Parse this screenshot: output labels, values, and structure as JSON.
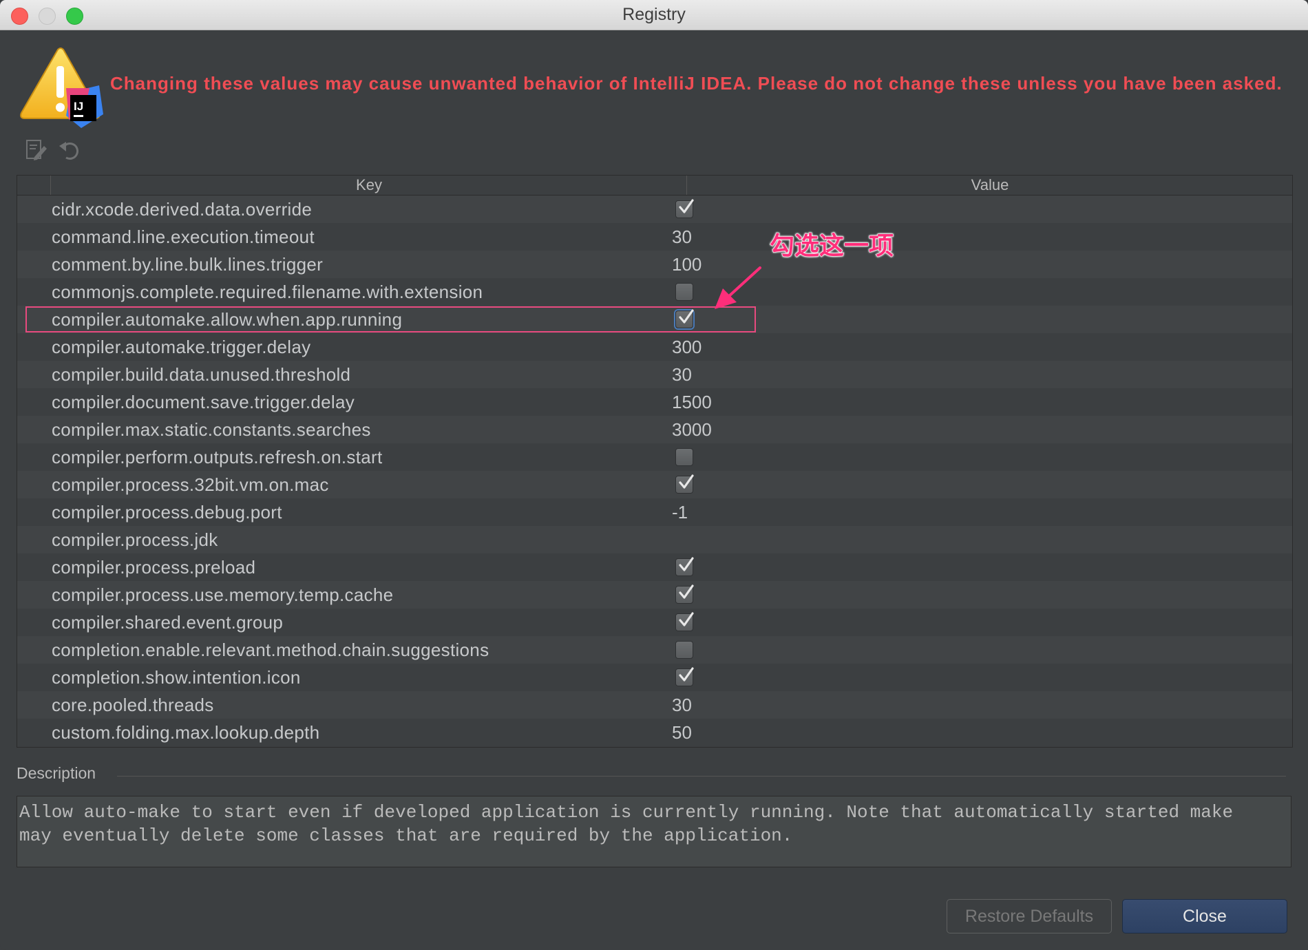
{
  "window": {
    "title": "Registry"
  },
  "warning": {
    "text": "Changing these values may cause unwanted behavior of IntelliJ IDEA. Please do not change these unless you have been asked.",
    "icon": "warning-intellij-icon",
    "logo_text": "IJ"
  },
  "toolbar": {
    "edit_icon": "edit-icon",
    "revert_icon": "revert-icon"
  },
  "table": {
    "columns": {
      "key": "Key",
      "value": "Value"
    },
    "rows": [
      {
        "key": "cidr.xcode.derived.data.override",
        "type": "checkbox",
        "checked": true
      },
      {
        "key": "command.line.execution.timeout",
        "type": "text",
        "value": "30"
      },
      {
        "key": "comment.by.line.bulk.lines.trigger",
        "type": "text",
        "value": "100"
      },
      {
        "key": "commonjs.complete.required.filename.with.extension",
        "type": "checkbox",
        "checked": false
      },
      {
        "key": "compiler.automake.allow.when.app.running",
        "type": "checkbox",
        "checked": true,
        "focused": true
      },
      {
        "key": "compiler.automake.trigger.delay",
        "type": "text",
        "value": "300"
      },
      {
        "key": "compiler.build.data.unused.threshold",
        "type": "text",
        "value": "30"
      },
      {
        "key": "compiler.document.save.trigger.delay",
        "type": "text",
        "value": "1500"
      },
      {
        "key": "compiler.max.static.constants.searches",
        "type": "text",
        "value": "3000"
      },
      {
        "key": "compiler.perform.outputs.refresh.on.start",
        "type": "checkbox",
        "checked": false
      },
      {
        "key": "compiler.process.32bit.vm.on.mac",
        "type": "checkbox",
        "checked": true
      },
      {
        "key": "compiler.process.debug.port",
        "type": "text",
        "value": "-1"
      },
      {
        "key": "compiler.process.jdk",
        "type": "text",
        "value": ""
      },
      {
        "key": "compiler.process.preload",
        "type": "checkbox",
        "checked": true
      },
      {
        "key": "compiler.process.use.memory.temp.cache",
        "type": "checkbox",
        "checked": true
      },
      {
        "key": "compiler.shared.event.group",
        "type": "checkbox",
        "checked": true
      },
      {
        "key": "completion.enable.relevant.method.chain.suggestions",
        "type": "checkbox",
        "checked": false
      },
      {
        "key": "completion.show.intention.icon",
        "type": "checkbox",
        "checked": true
      },
      {
        "key": "core.pooled.threads",
        "type": "text",
        "value": "30"
      },
      {
        "key": "custom.folding.max.lookup.depth",
        "type": "text",
        "value": "50"
      }
    ]
  },
  "annotation": {
    "text": "勾选这一项",
    "color": "#ff2e7a"
  },
  "description": {
    "label": "Description",
    "text": "Allow auto-make to start even if developed application is currently running. Note that automatically started make\nmay eventually delete some classes that are required by the application."
  },
  "buttons": {
    "restore": "Restore Defaults",
    "close": "Close"
  }
}
